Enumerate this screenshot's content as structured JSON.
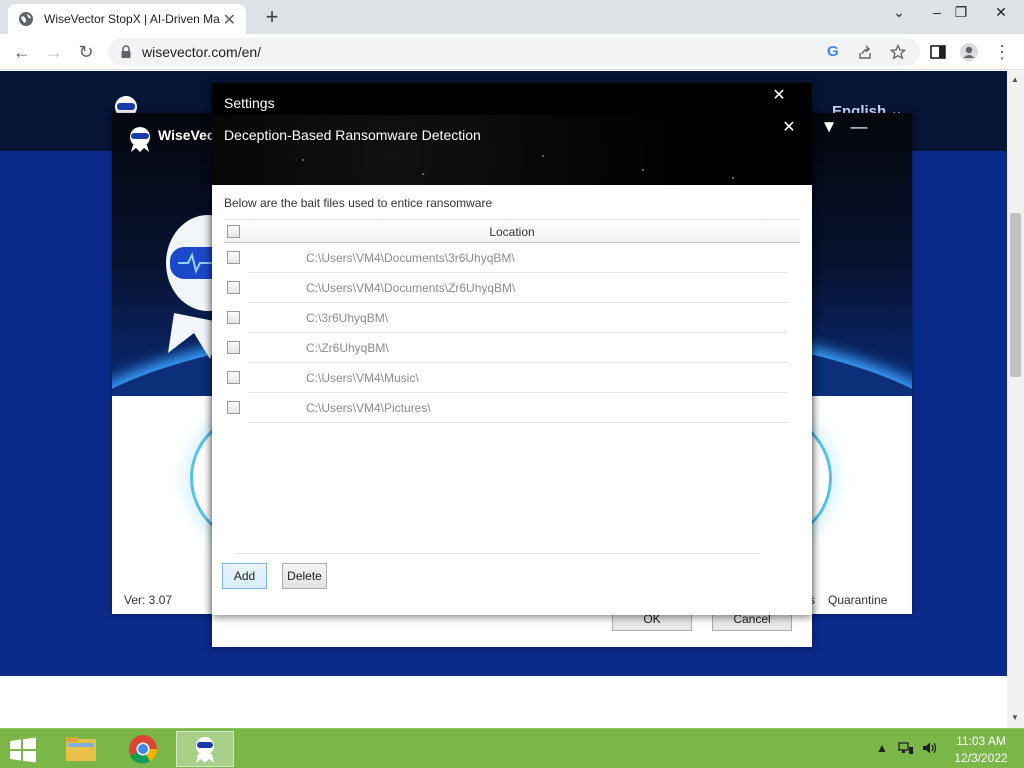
{
  "browser": {
    "tab_title": "WiseVector StopX | AI-Driven Ma",
    "tab_close": "✕",
    "new_tab": "+",
    "url": "wisevector.com/en/",
    "google_letter": "G"
  },
  "site": {
    "language": "English ⌄"
  },
  "app": {
    "name": "WiseVector",
    "version": "Ver: 3.07",
    "partial_text": "s",
    "quarantine": "Quarantine"
  },
  "settings": {
    "title": "Settings",
    "close": "✕",
    "ok": "OK",
    "cancel": "Cancel"
  },
  "deception": {
    "title": "Deception-Based Ransomware Detection",
    "close": "✕",
    "description": "Below are the bait files used to entice ransomware",
    "column_location": "Location",
    "rows": [
      "C:\\Users\\VM4\\Documents\\3r6UhyqBM\\",
      "C:\\Users\\VM4\\Documents\\Zr6UhyqBM\\",
      "C:\\3r6UhyqBM\\",
      "C:\\Zr6UhyqBM\\",
      "C:\\Users\\VM4\\Music\\",
      "C:\\Users\\VM4\\Pictures\\"
    ],
    "add": "Add",
    "delete": "Delete"
  },
  "taskbar": {
    "time": "11:03 AM",
    "date": "12/3/2022",
    "tray_arrow": "▲"
  },
  "colors": {
    "taskbar": "#7ab648",
    "page_blue": "#0b2a8a",
    "accent_ring": "#54c3e8"
  }
}
